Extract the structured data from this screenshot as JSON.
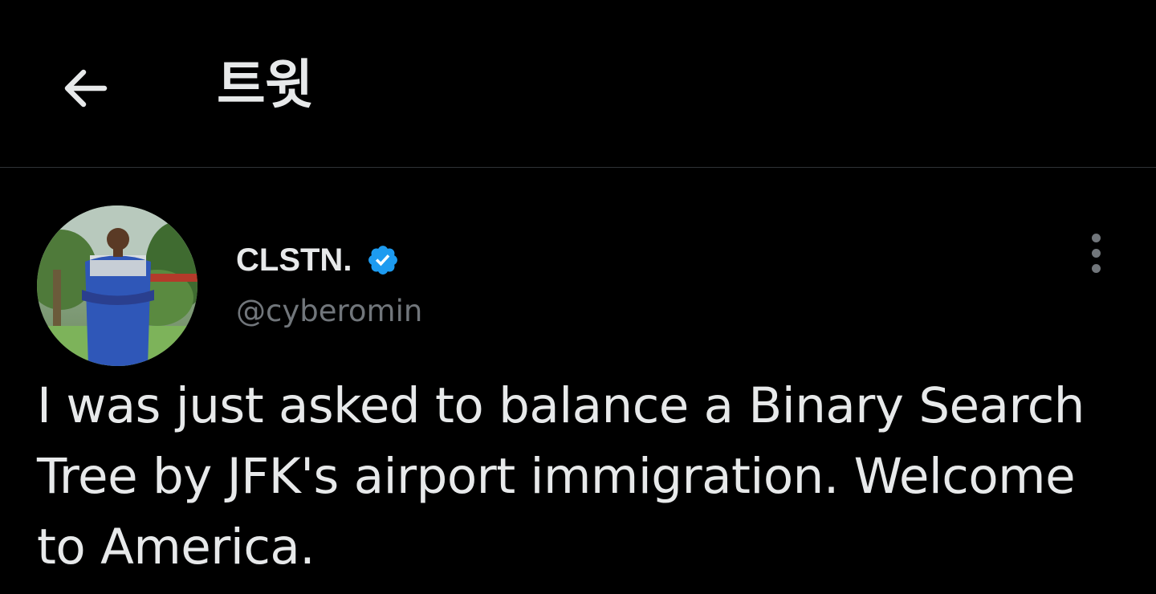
{
  "header": {
    "back_icon": "arrow-left-icon",
    "title": "트윗"
  },
  "tweet": {
    "author": {
      "display_name": "CLSTN.",
      "handle": "@cyberomin",
      "verified": true,
      "verified_color": "#1d9bf0"
    },
    "more_icon": "more-vertical-icon",
    "text": "I was just asked to balance a Binary Search Tree by JFK's airport immigration. Welcome to America."
  },
  "colors": {
    "background": "#000000",
    "text_primary": "#e7e9ea",
    "text_secondary": "#71767b",
    "divider": "#2f3336",
    "accent": "#1d9bf0"
  }
}
